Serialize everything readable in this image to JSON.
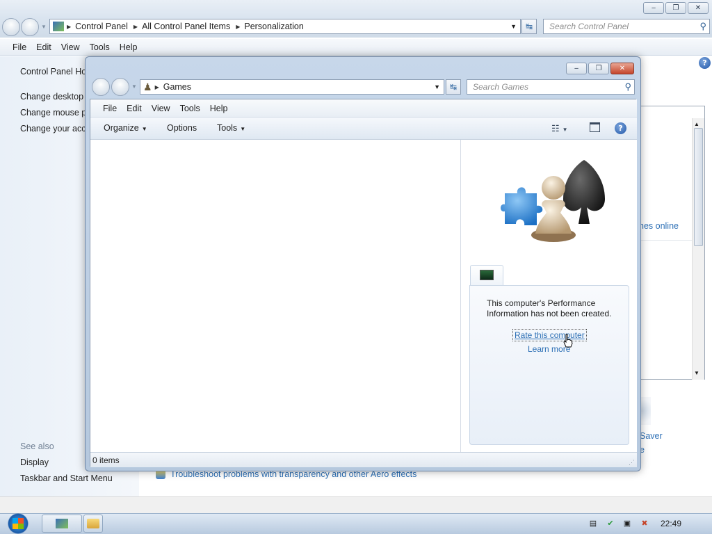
{
  "background_window": {
    "address": {
      "segments": [
        "Control Panel",
        "All Control Panel Items",
        "Personalization"
      ],
      "search_placeholder": "Search Control Panel"
    },
    "menu": [
      "File",
      "Edit",
      "View",
      "Tools",
      "Help"
    ],
    "left_nav": {
      "links": [
        "Control Panel Ho",
        "Change desktop i",
        "Change mouse p",
        "Change your acco"
      ],
      "see_also_heading": "See also",
      "see_also": [
        "Display",
        "Taskbar and Start Menu"
      ]
    },
    "right_fragments": [
      "nes online",
      "Saver",
      "e"
    ],
    "troubleshoot_link": "Troubleshoot problems with transparency and other Aero effects"
  },
  "games_window": {
    "address": {
      "segment": "Games",
      "search_placeholder": "Search Games"
    },
    "menu": [
      "File",
      "Edit",
      "View",
      "Tools",
      "Help"
    ],
    "toolbar": {
      "organize": "Organize",
      "options": "Options",
      "tools": "Tools"
    },
    "details_pane": {
      "message": "This computer's Performance Information has not been created.",
      "rate_link": "Rate this computer",
      "learn_link": "Learn more"
    },
    "status": "0 items"
  },
  "taskbar": {
    "clock": "22:49"
  },
  "colors": {
    "link": "#2c6fb5",
    "frame": "#b5c8de",
    "close": "#c5452b"
  }
}
